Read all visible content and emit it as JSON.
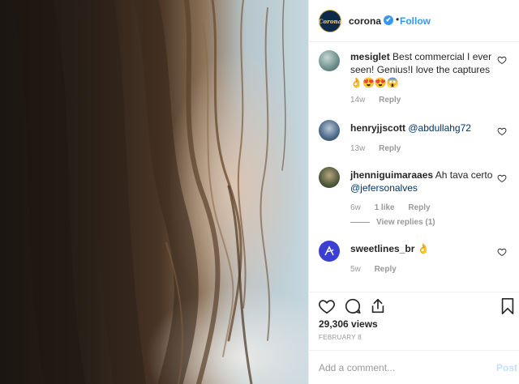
{
  "post": {
    "account": "corona",
    "avatar_text": "Corona",
    "verified_mark": "✔",
    "separator": "•",
    "follow_label": "Follow"
  },
  "comments": [
    {
      "user": "mesiglet",
      "text": "Best commercial I ever seen! Genius!I love the captures",
      "emoji": "👌😍😍😱",
      "time": "14w",
      "reply_label": "Reply"
    },
    {
      "user": "henryjjscott",
      "mention": "@abdullahg72",
      "time": "13w",
      "reply_label": "Reply"
    },
    {
      "user": "jhenniguimaraaes",
      "text": "Ah tava certo",
      "mention": "@jefersonalves",
      "time": "6w",
      "likes": "1 like",
      "reply_label": "Reply",
      "view_replies": "View replies (1)"
    },
    {
      "user": "sweetlines_br",
      "emoji": "👌",
      "time": "5w",
      "reply_label": "Reply"
    }
  ],
  "stats": {
    "views": "29,306 views",
    "date": "FEBRUARY 8"
  },
  "compose": {
    "placeholder": "Add a comment...",
    "post_label": "Post"
  },
  "icons": [
    "heart-icon",
    "comment-icon",
    "share-icon",
    "bookmark-icon",
    "verified-icon"
  ],
  "colors": {
    "link": "#3897f0",
    "muted": "#999999",
    "post_disabled": "#c5dffa"
  }
}
